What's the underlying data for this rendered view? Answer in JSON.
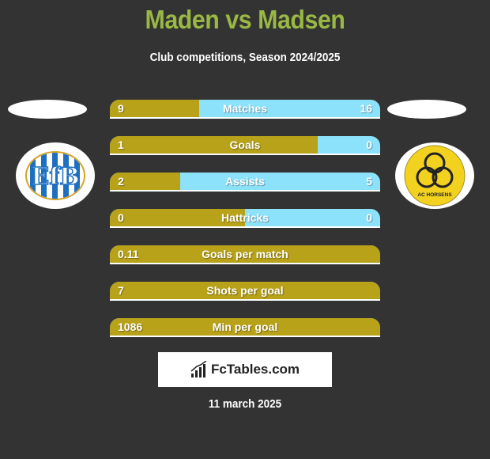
{
  "header": {
    "title": "Maden vs Madsen",
    "subtitle": "Club competitions, Season 2024/2025"
  },
  "teams": {
    "left": {
      "logo_icon": "esbjerg-fb-crest-icon",
      "logo_text": "EfB"
    },
    "right": {
      "logo_icon": "ac-horsens-crest-icon",
      "logo_text": "AC HORSENS"
    }
  },
  "colors": {
    "left": "#b8a21a",
    "right": "#8de2fb",
    "title": "#99b844",
    "background": "#333333"
  },
  "stats": [
    {
      "label": "Matches",
      "left": "9",
      "right": "16",
      "left_share": 0.33
    },
    {
      "label": "Goals",
      "left": "1",
      "right": "0",
      "left_share": 0.77
    },
    {
      "label": "Assists",
      "left": "2",
      "right": "5",
      "left_share": 0.26
    },
    {
      "label": "Hattricks",
      "left": "0",
      "right": "0",
      "left_share": 0.5
    },
    {
      "label": "Goals per match",
      "left": "0.11",
      "right": "",
      "left_share": 1
    },
    {
      "label": "Shots per goal",
      "left": "7",
      "right": "",
      "left_share": 1
    },
    {
      "label": "Min per goal",
      "left": "1086",
      "right": "",
      "left_share": 1
    }
  ],
  "footer": {
    "brand": "FcTables.com",
    "date": "11 march 2025"
  }
}
